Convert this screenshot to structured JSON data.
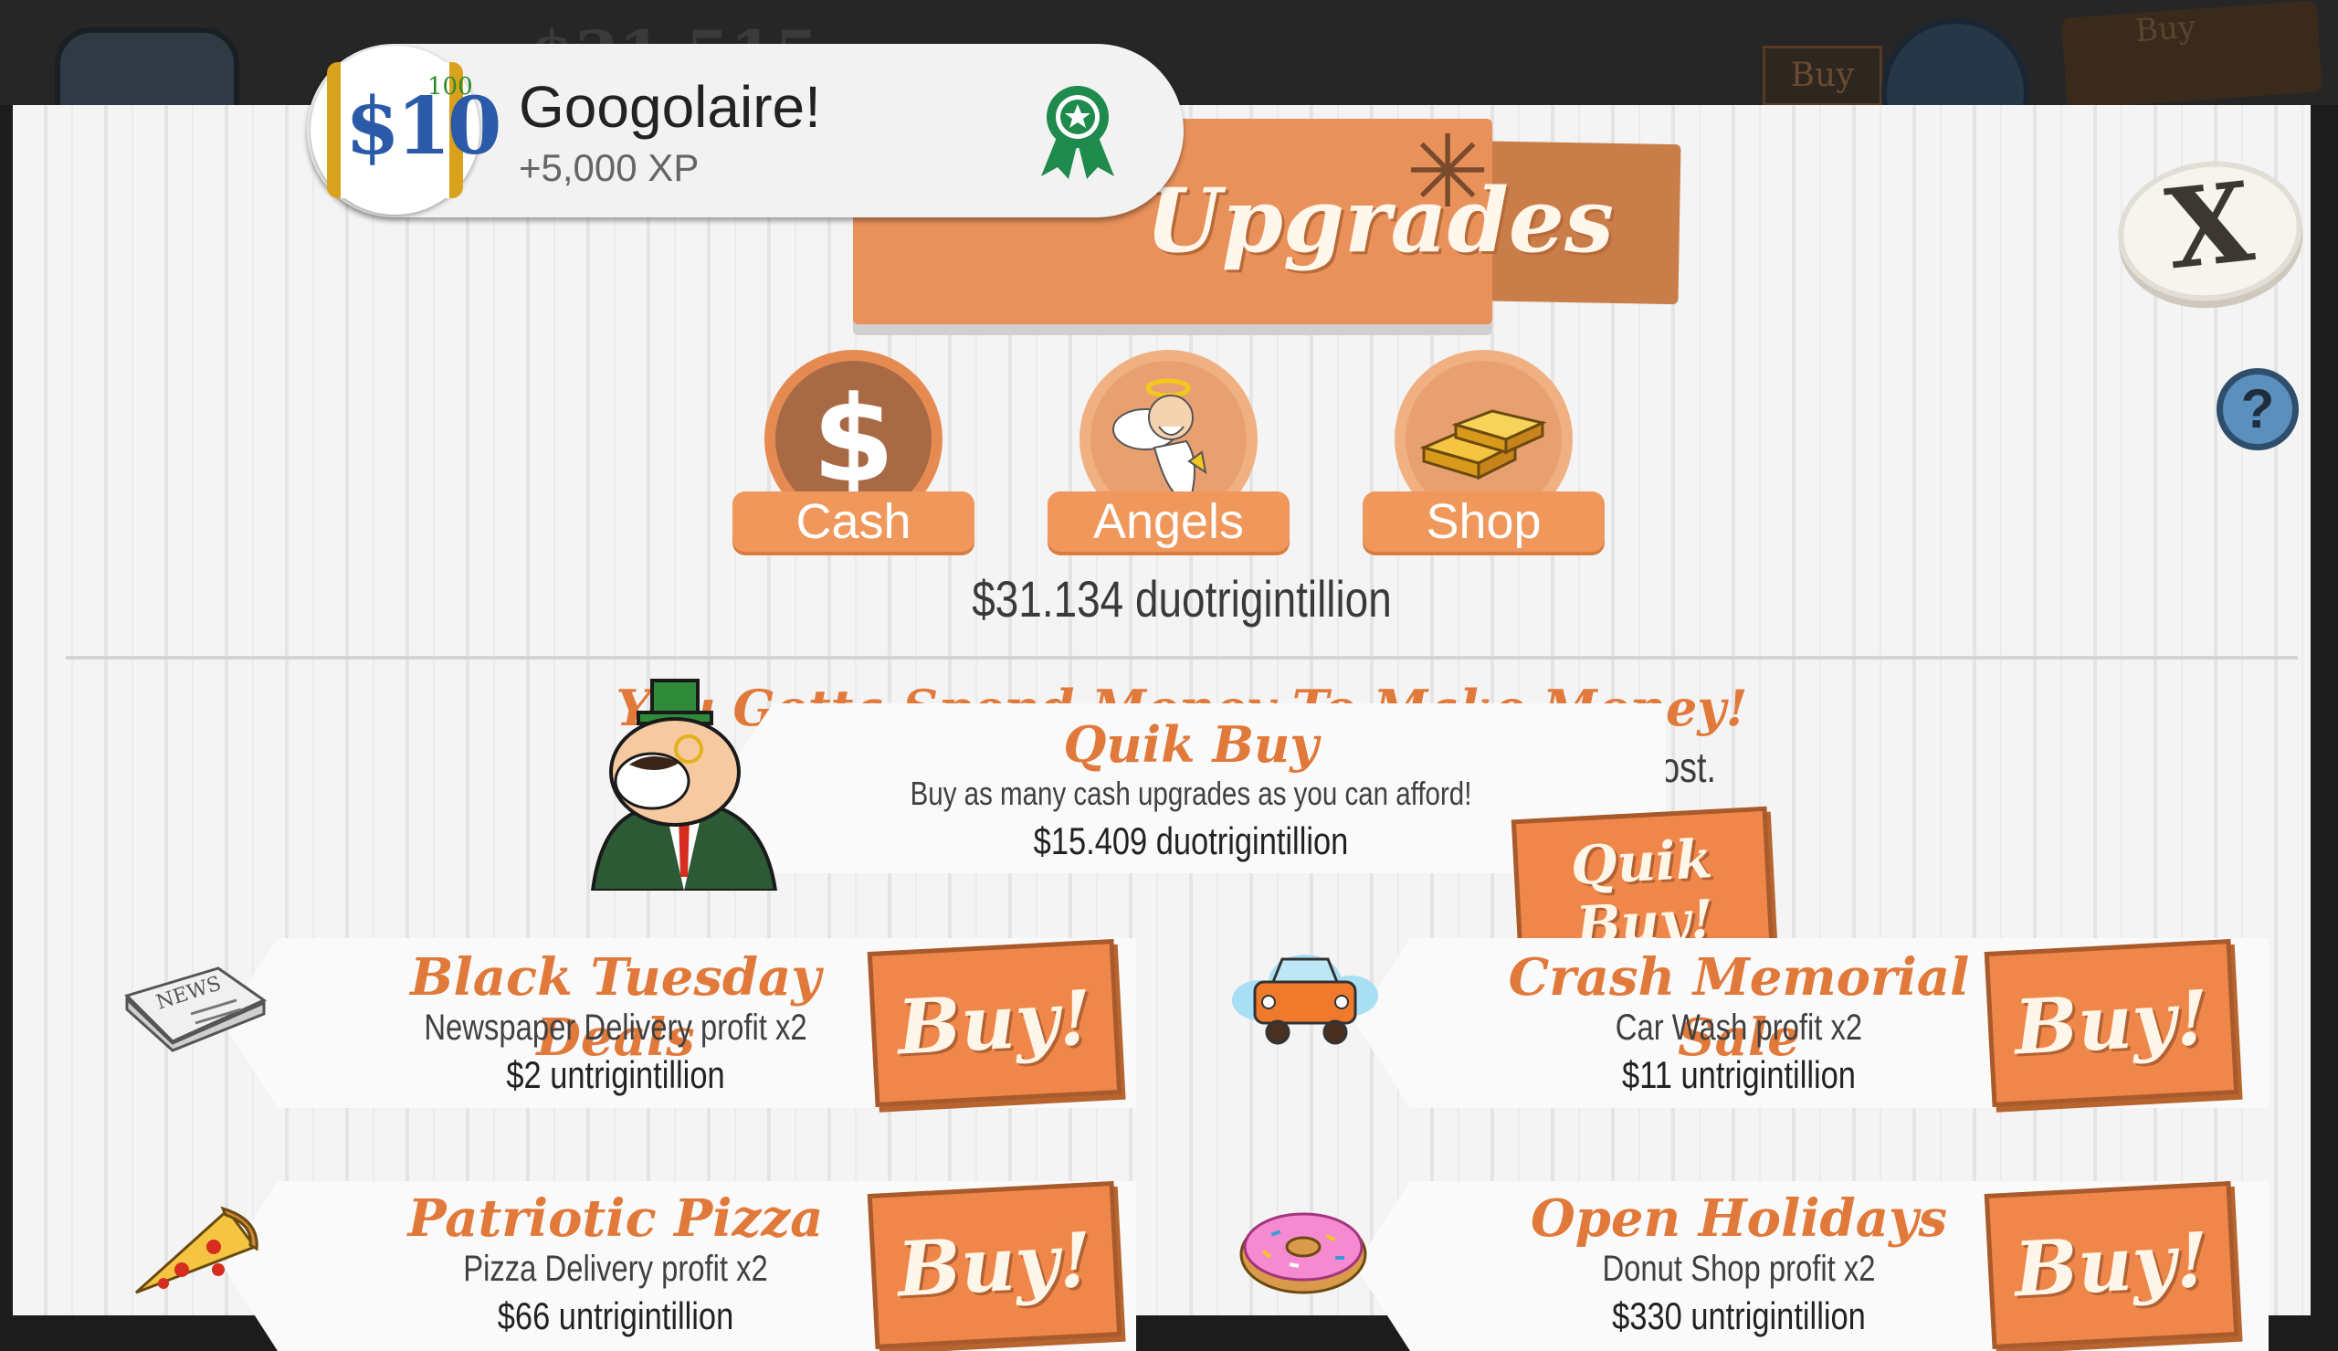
{
  "background": {
    "money_text": "$31.515",
    "buy_label": "Buy",
    "tag_label": "Buy"
  },
  "header": {
    "title": "Upgrades",
    "close_label": "X",
    "help_label": "?"
  },
  "achievement_toast": {
    "badge_text": "$10",
    "badge_superscript": "100",
    "title": "Googolaire!",
    "xp": "+5,000 XP",
    "ribbon_icon": "award-ribbon-icon"
  },
  "tabs": [
    {
      "label": "Cash",
      "icon": "dollar-icon"
    },
    {
      "label": "Angels",
      "icon": "angel-icon"
    },
    {
      "label": "Shop",
      "icon": "gold-bars-icon"
    }
  ],
  "balance": "$31.134 duotrigintillion",
  "intro": {
    "slogan": "You Gotta Spend Money To Make Money!",
    "subtitle": "Purchase these fine quality upgrades to give your businesses a boost."
  },
  "quik_buy": {
    "title": "Quik Buy",
    "description": "Buy as many cash upgrades as you can afford!",
    "price": "$15.409 duotrigintillion",
    "button_line1": "Quik",
    "button_line2": "Buy!",
    "icon": "capitalist-mascot-icon"
  },
  "upgrades": [
    {
      "title": "Black Tuesday Deals",
      "description": "Newspaper Delivery profit x2",
      "price": "$2 untrigintillion",
      "button": "Buy!",
      "icon": "newspaper-icon"
    },
    {
      "title": "Crash Memorial Sale",
      "description": "Car Wash profit x2",
      "price": "$11 untrigintillion",
      "button": "Buy!",
      "icon": "car-wash-icon"
    },
    {
      "title": "Patriotic Pizza",
      "description": "Pizza Delivery profit x2",
      "price": "$66 untrigintillion",
      "button": "Buy!",
      "icon": "pizza-icon"
    },
    {
      "title": "Open Holidays",
      "description": "Donut Shop profit x2",
      "price": "$330 untrigintillion",
      "button": "Buy!",
      "icon": "donut-icon"
    }
  ]
}
